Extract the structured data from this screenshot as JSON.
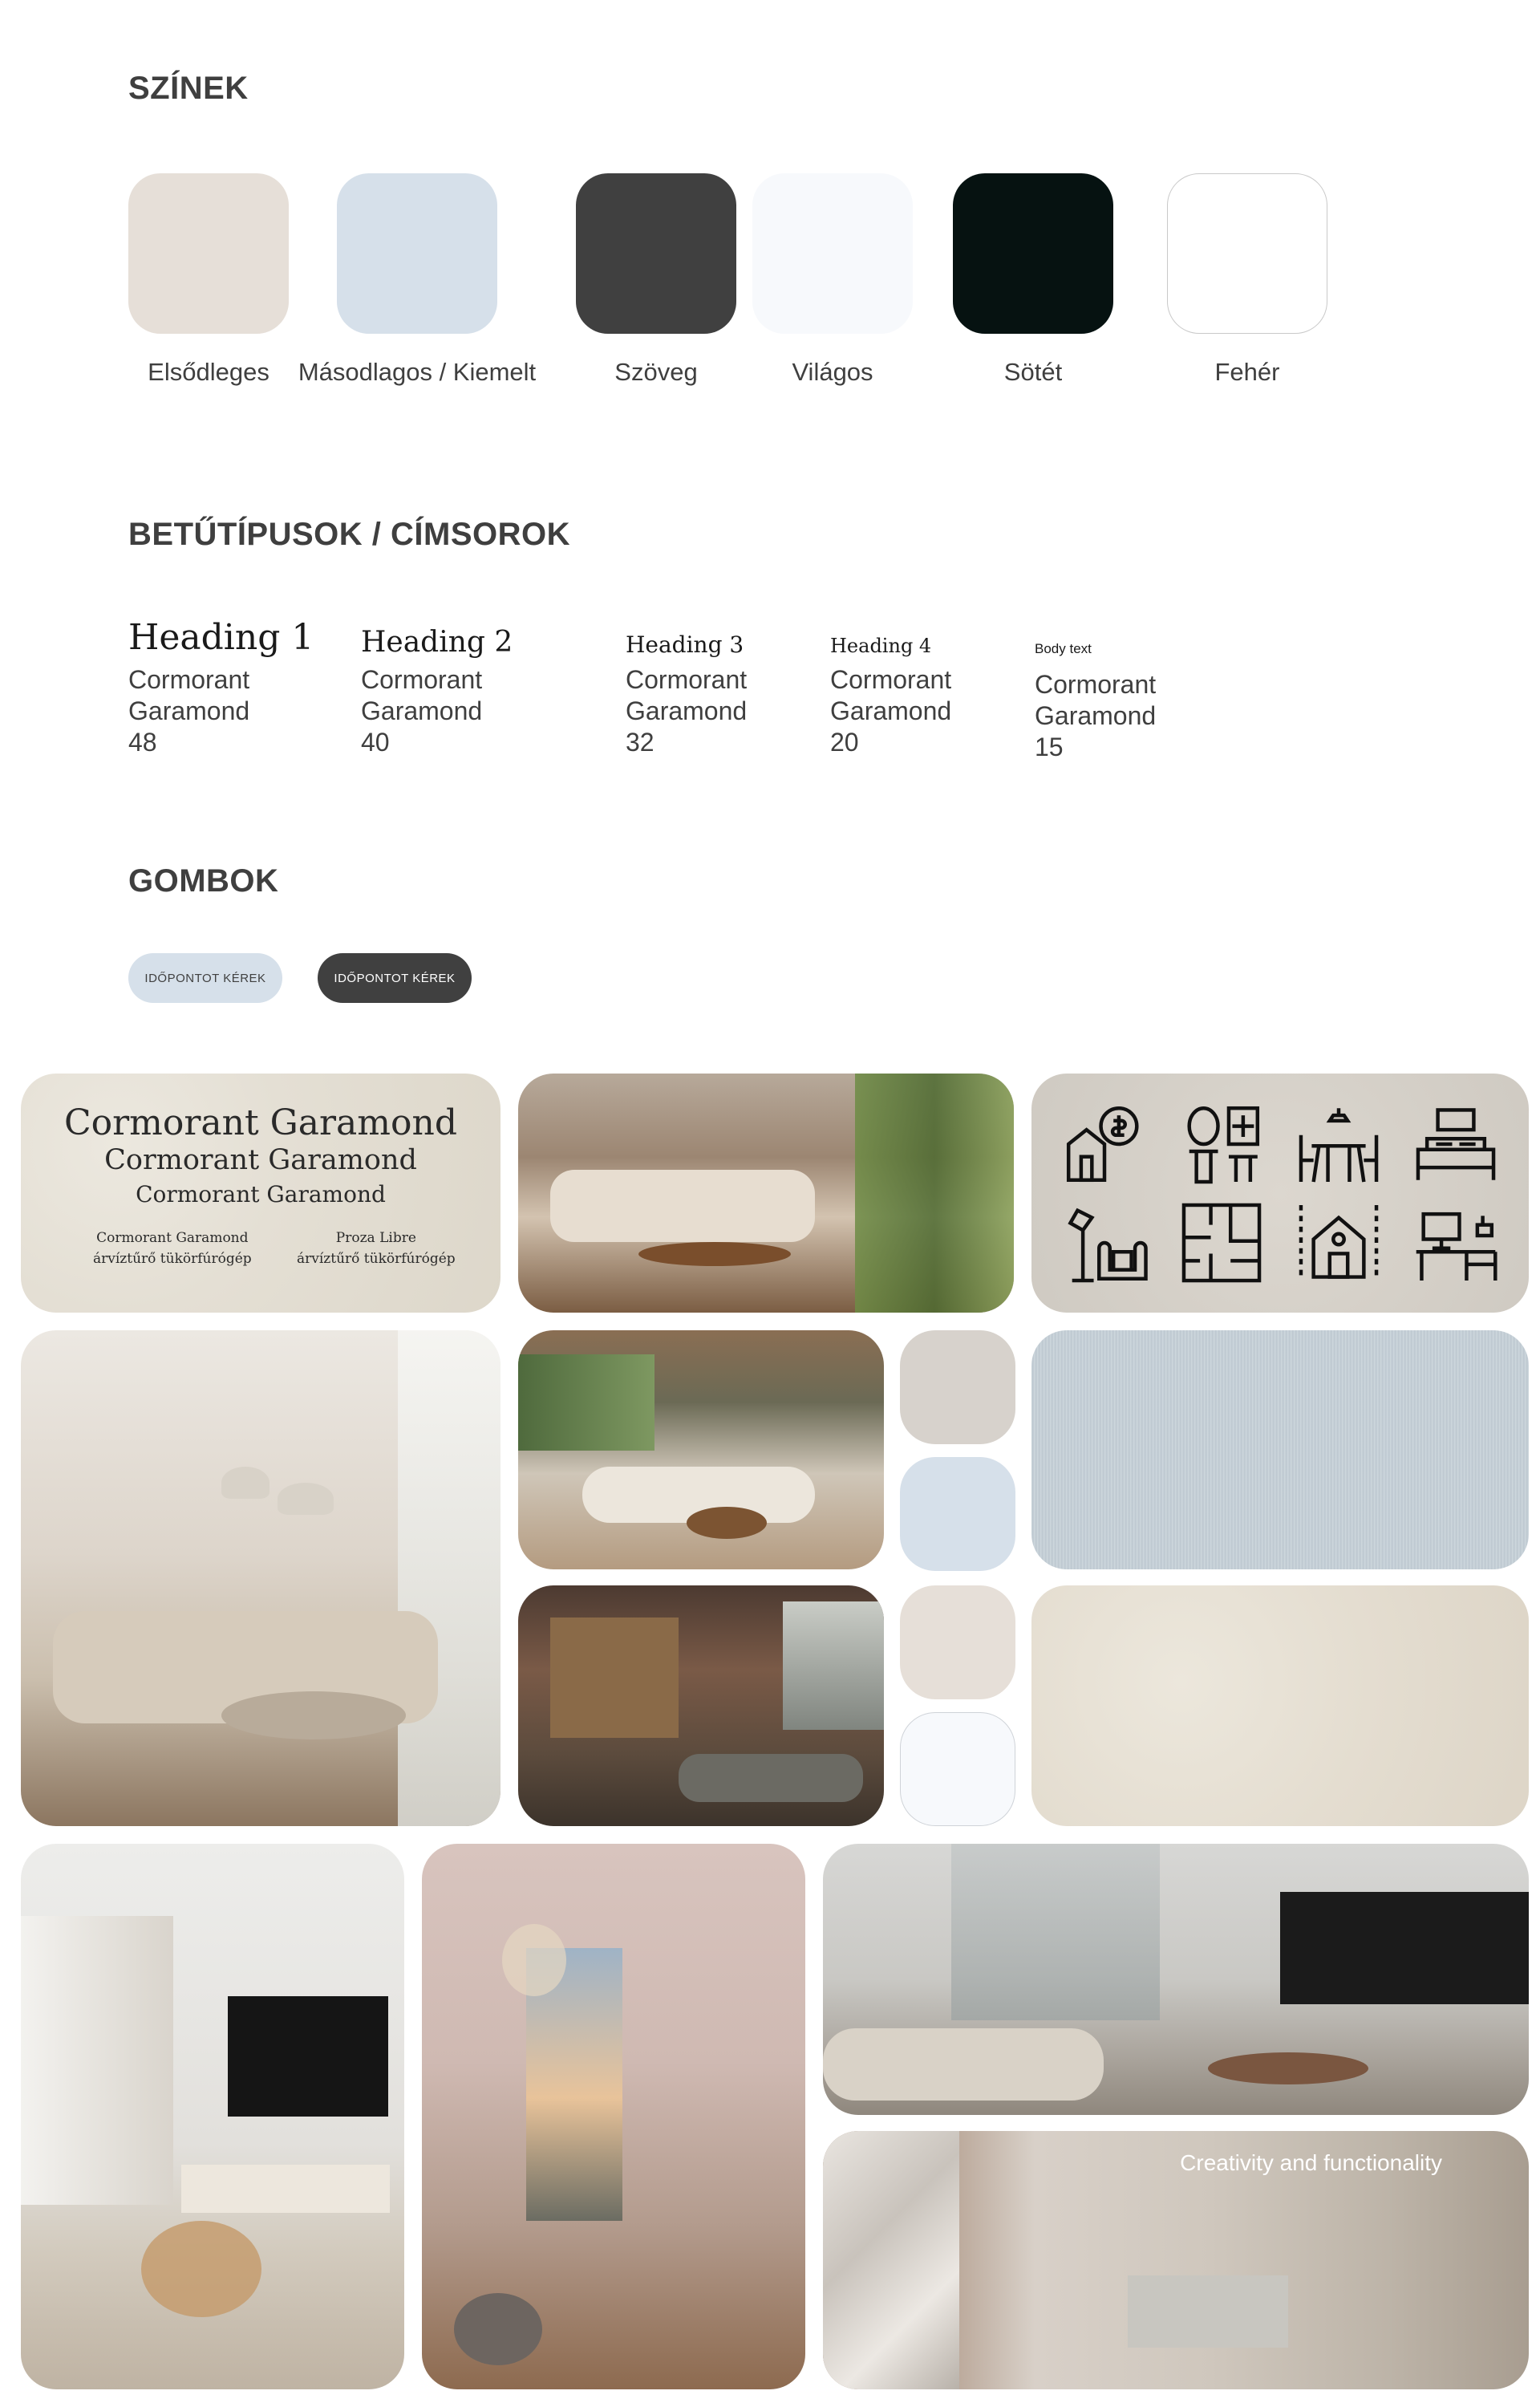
{
  "sections": {
    "colors_title": "SZÍNEK",
    "fonts_title": "BETŰTÍPUSOK / CÍMSOROK",
    "buttons_title": "GOMBOK"
  },
  "colors": [
    {
      "label": "Elsődleges",
      "hex": "#E6DFD8"
    },
    {
      "label": "Másodlagos / Kiemelt",
      "hex": "#D6E0EA"
    },
    {
      "label": "Szöveg",
      "hex": "#404040"
    },
    {
      "label": "Világos",
      "hex": "#F7F9FC"
    },
    {
      "label": "Sötét",
      "hex": "#061211"
    },
    {
      "label": "Fehér",
      "hex": "#FFFFFF"
    }
  ],
  "fonts": [
    {
      "sample": "Heading 1",
      "family_line1": "Cormorant",
      "family_line2": "Garamond",
      "size": "48"
    },
    {
      "sample": "Heading 2",
      "family_line1": "Cormorant",
      "family_line2": "Garamond",
      "size": "40"
    },
    {
      "sample": "Heading 3",
      "family_line1": "Cormorant",
      "family_line2": "Garamond",
      "size": "32"
    },
    {
      "sample": "Heading 4",
      "family_line1": "Cormorant",
      "family_line2": "Garamond",
      "size": "20"
    },
    {
      "sample": "Body text",
      "family_line1": "Cormorant",
      "family_line2": "Garamond",
      "size": "15"
    }
  ],
  "buttons": [
    {
      "label": "IDŐPONTOT KÉREK",
      "bg": "#D6E0EA",
      "fg": "#404040"
    },
    {
      "label": "IDŐPONTOT KÉREK",
      "bg": "#404040",
      "fg": "#FFFFFF"
    }
  ],
  "moodboard": {
    "typography_card": {
      "line1": "Cormorant Garamond",
      "line2": "Cormorant Garamond",
      "line3": "Cormorant Garamond",
      "left_font": "Cormorant Garamond",
      "left_sample": "árvíztűrő tükörfúrógép",
      "right_font": "Proza Libre",
      "right_sample": "árvíztűrő tükörfúrógép"
    },
    "icons": [
      "home-finance-icon",
      "bathroom-icon",
      "dining-icon",
      "bedroom-icon",
      "armchair-lamp-icon",
      "floor-plan-icon",
      "house-measure-icon",
      "desk-icon"
    ],
    "small_swatches": [
      "#D7D2CC",
      "#D6E0EA",
      "#E6DFD8",
      "#F7F9FC"
    ],
    "caption": "Creativity and functionality"
  }
}
